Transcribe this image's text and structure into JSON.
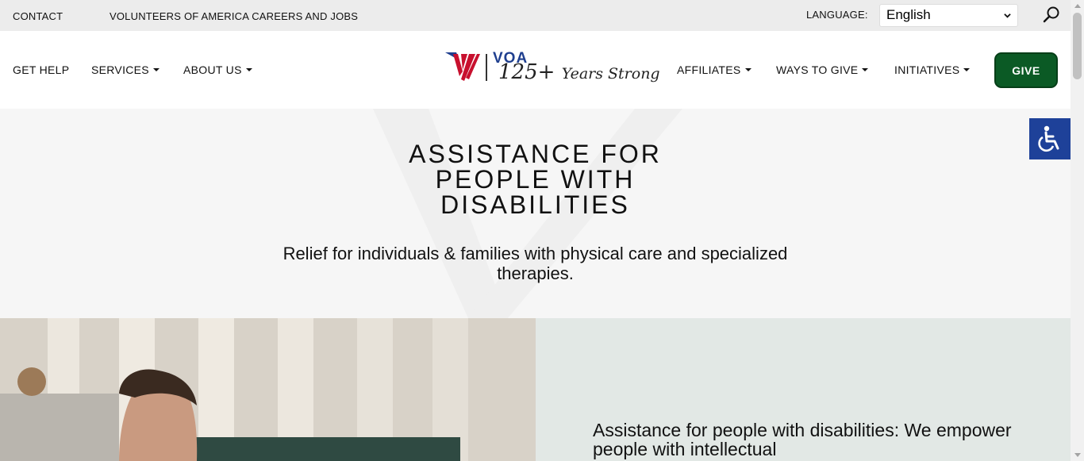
{
  "topbar": {
    "contact": "CONTACT",
    "careers": "VOLUNTEERS OF AMERICA CAREERS AND JOBS",
    "language_label": "LANGUAGE:",
    "language_value": "English",
    "search_icon": "search-icon"
  },
  "nav": {
    "left": [
      {
        "label": "GET HELP",
        "dropdown": false
      },
      {
        "label": "SERVICES",
        "dropdown": true
      },
      {
        "label": "ABOUT US",
        "dropdown": true
      }
    ],
    "right": [
      {
        "label": "AFFILIATES",
        "dropdown": true
      },
      {
        "label": "WAYS TO GIVE",
        "dropdown": true
      },
      {
        "label": "INITIATIVES",
        "dropdown": true
      }
    ],
    "give_label": "GIVE"
  },
  "logo": {
    "abbr": "VOA",
    "years": "125+",
    "tagline": "Years Strong"
  },
  "hero": {
    "title_lines": [
      "ASSISTANCE FOR",
      "PEOPLE WITH",
      "DISABILITIES"
    ],
    "subtitle": "Relief for individuals & families with physical care and specialized therapies."
  },
  "panel": {
    "text": "Assistance for people with disabilities: We empower people with intellectual"
  },
  "colors": {
    "brand_red": "#c8102e",
    "brand_blue": "#1f3f8f",
    "give_green": "#0b5a25",
    "a11y_blue": "#1e4199",
    "panel_bg": "#e2e8e5"
  }
}
